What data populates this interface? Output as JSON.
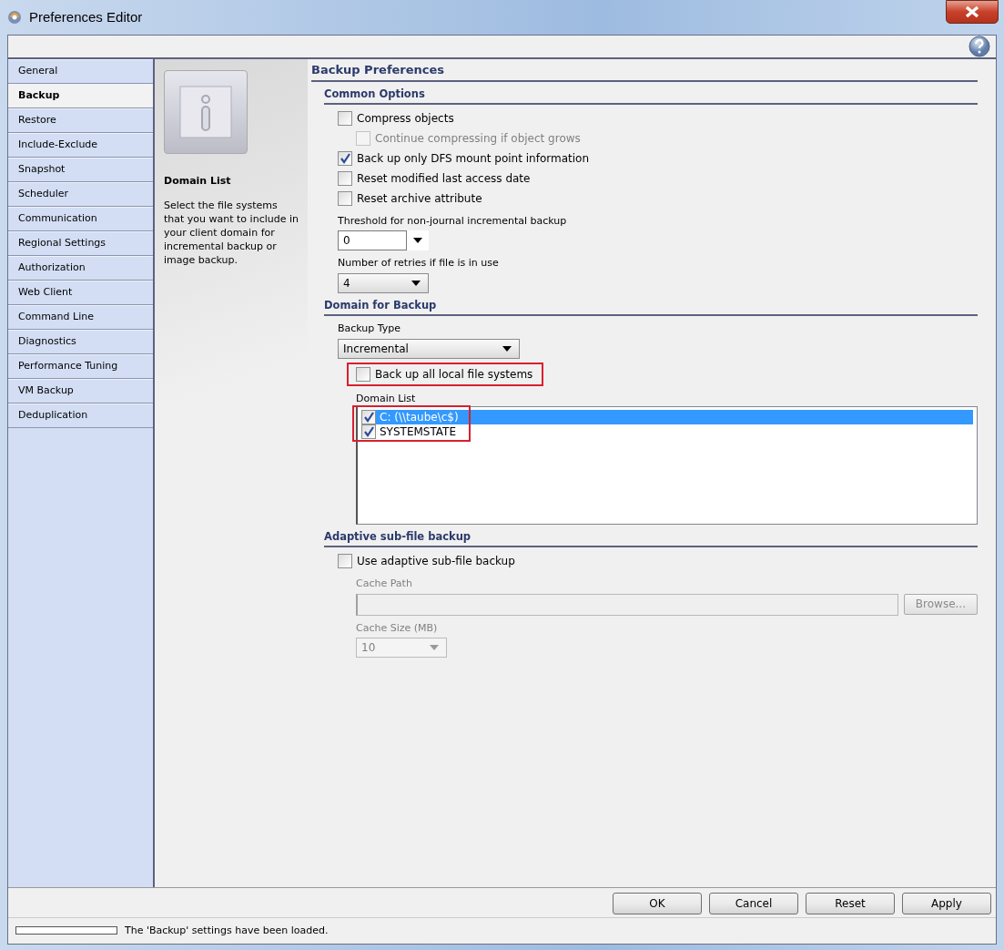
{
  "window": {
    "title": "Preferences Editor"
  },
  "sidebar": {
    "items": [
      {
        "label": "General",
        "selected": false
      },
      {
        "label": "Backup",
        "selected": true
      },
      {
        "label": "Restore",
        "selected": false
      },
      {
        "label": "Include-Exclude",
        "selected": false
      },
      {
        "label": "Snapshot",
        "selected": false
      },
      {
        "label": "Scheduler",
        "selected": false
      },
      {
        "label": "Communication",
        "selected": false
      },
      {
        "label": "Regional Settings",
        "selected": false
      },
      {
        "label": "Authorization",
        "selected": false
      },
      {
        "label": "Web Client",
        "selected": false
      },
      {
        "label": "Command Line",
        "selected": false
      },
      {
        "label": "Diagnostics",
        "selected": false
      },
      {
        "label": "Performance Tuning",
        "selected": false
      },
      {
        "label": "VM Backup",
        "selected": false
      },
      {
        "label": "Deduplication",
        "selected": false
      }
    ]
  },
  "info": {
    "title": "Domain List",
    "text": "Select the file systems that you want to include in your client domain for incremental backup or image backup."
  },
  "page": {
    "title": "Backup Preferences",
    "sections": [
      {
        "title": "Common Options",
        "controls": [
          {
            "kind": "checkbox",
            "label": "Compress objects",
            "checked": false,
            "disabled": false,
            "children": [
              {
                "kind": "checkbox",
                "label": "Continue compressing if object grows",
                "checked": false,
                "disabled": true
              }
            ]
          },
          {
            "kind": "checkbox",
            "label": "Back up only DFS mount point information",
            "checked": true,
            "disabled": false
          },
          {
            "kind": "checkbox",
            "label": "Reset modified last access date",
            "checked": false,
            "disabled": false
          },
          {
            "kind": "checkbox",
            "label": "Reset archive attribute",
            "checked": false,
            "disabled": false
          },
          {
            "kind": "combo",
            "label": "Threshold for non-journal incremental backup",
            "value": "0"
          },
          {
            "kind": "dropdown",
            "label": "Number of retries if file is in use",
            "value": "4",
            "disabled": false
          }
        ]
      },
      {
        "title": "Domain for Backup",
        "controls": [
          {
            "kind": "wide-dropdown",
            "label": "Backup Type",
            "value": "Incremental",
            "disabled": false
          },
          {
            "kind": "checkbox",
            "label": "Back up all local file systems",
            "checked": false,
            "disabled": false,
            "highlighted": true
          },
          {
            "kind": "list",
            "label": "Domain List",
            "highlighted": true,
            "items": [
              {
                "label": "C: (\\\\taube\\c$)",
                "checked": true,
                "selected": true
              },
              {
                "label": "SYSTEMSTATE",
                "checked": true,
                "selected": false
              }
            ]
          }
        ]
      },
      {
        "title": "Adaptive sub-file backup",
        "controls": [
          {
            "kind": "checkbox",
            "label": "Use adaptive sub-file backup",
            "checked": false,
            "disabled": false,
            "children": [
              {
                "kind": "path",
                "label": "Cache Path",
                "button": "Browse...",
                "disabled": true
              },
              {
                "kind": "dropdown",
                "label": "Cache Size (MB)",
                "value": "10",
                "disabled": true
              }
            ]
          }
        ]
      }
    ]
  },
  "buttons": [
    "OK",
    "Cancel",
    "Reset",
    "Apply"
  ],
  "status_bar": {
    "message": "The 'Backup' settings have been loaded.",
    "level": 0
  }
}
